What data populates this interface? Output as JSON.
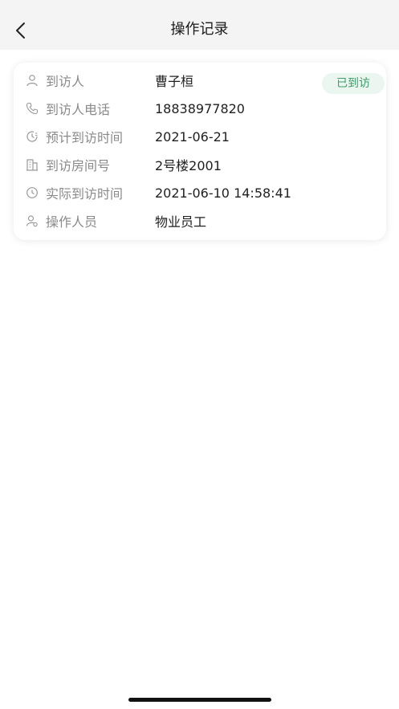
{
  "header": {
    "title": "操作记录"
  },
  "record": {
    "status": "已到访",
    "rows": [
      {
        "icon": "person-icon",
        "label": "到访人",
        "value": "曹子桓"
      },
      {
        "icon": "phone-icon",
        "label": "到访人电话",
        "value": "18838977820"
      },
      {
        "icon": "clock-plan-icon",
        "label": "预计到访时间",
        "value": "2021-06-21"
      },
      {
        "icon": "building-icon",
        "label": "到访房间号",
        "value": "2号楼2001"
      },
      {
        "icon": "clock-icon",
        "label": "实际到访时间",
        "value": "2021-06-10 14:58:41"
      },
      {
        "icon": "staff-icon",
        "label": "操作人员",
        "value": "物业员工"
      }
    ]
  },
  "colors": {
    "status_text": "#3e9c69",
    "status_bg": "#eaf6ef",
    "label": "#8a8a8a",
    "navbar_bg": "#f4f4f4"
  }
}
